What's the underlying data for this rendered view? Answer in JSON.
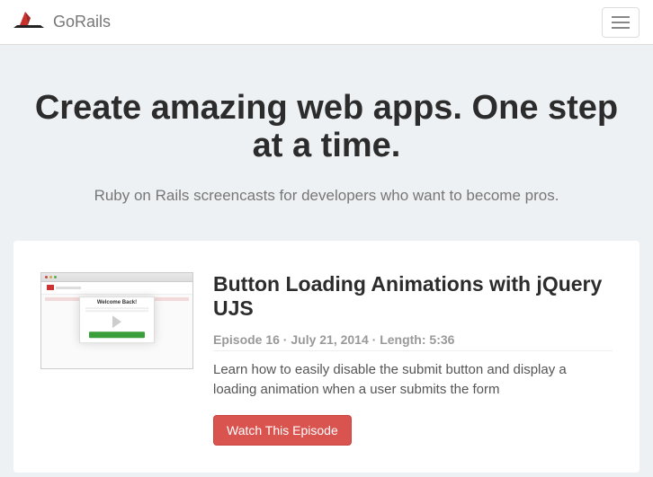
{
  "brand": "GoRails",
  "hero": {
    "title": "Create amazing web apps. One step at a time.",
    "subtitle": "Ruby on Rails screencasts for developers who want to become pros."
  },
  "episode": {
    "title": "Button Loading Animations with jQuery UJS",
    "meta": "Episode 16 · July 21, 2014 · Length: 5:36",
    "description": "Learn how to easily disable the submit button and display a loading animation when a user submits the form",
    "watch_label": "Watch This Episode",
    "thumb_modal_title": "Welcome Back!"
  }
}
